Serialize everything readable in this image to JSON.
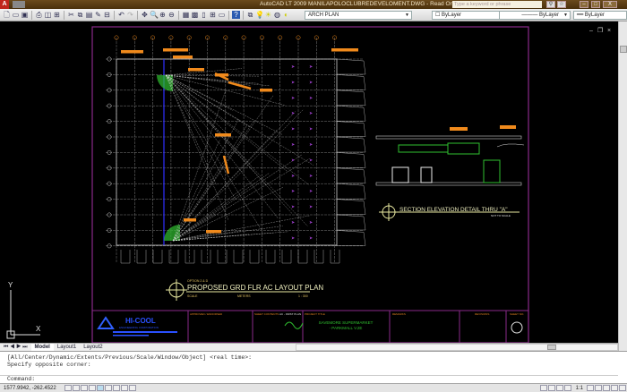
{
  "window": {
    "title": "AutoCAD LT 2009  MANILAPOLOCLUBREDEVELOMENT.DWG - Read Only",
    "search_placeholder": "Type a keyword or phrase",
    "minimize": "–",
    "maximize": "□",
    "close": "X"
  },
  "toolbar": {
    "layer": "ARCH PLAN",
    "color": "ByLayer",
    "linetype": "ByLayer",
    "lineweight": "ByLayer"
  },
  "drawing": {
    "plan_title": "PROPOSED GRD FLR AC LAYOUT PLAN",
    "plan_option": "OPTION 2 & D",
    "plan_scale_label": "SCALE",
    "plan_scale_unit": "METERS",
    "plan_scale": "1 : 300",
    "section_title": "SECTION ELEVATION DETAIL THRU \"A\"",
    "section_note": "NOT TO SCALE",
    "company": "HI-COOL",
    "company_sub": "ENGINEERING CORPORATION",
    "project": "SAVEMORE SUPERMARKET",
    "project_sub": "- PARKMALL V.2E",
    "sheet_content_label": "SHEET CONTENTS",
    "sheet_content": "AC - FIRST PLAN",
    "project_title_label": "PROJECT TITLE",
    "remarks": "REMARKS",
    "revisions": "REVISIONS",
    "sheet_no": "SHEET NO."
  },
  "tabs": [
    "Model",
    "Layout1",
    "Layout2"
  ],
  "command": {
    "history": [
      "[All/Center/Dynamic/Extents/Previous/Scale/Window/Object] <real time>:",
      "Specify opposite corner:"
    ],
    "prompt": "Command:"
  },
  "status": {
    "coordinates": "1577.9942, -262.4522",
    "scale": "1:1"
  },
  "colors": {
    "accent": "#f08a1c",
    "frame": "#8a2a8a",
    "grid": "#cfcfcf",
    "duct": "#f08a1c",
    "diffuser": "#a040d0",
    "green": "#30c030",
    "blue": "#3030ff"
  }
}
